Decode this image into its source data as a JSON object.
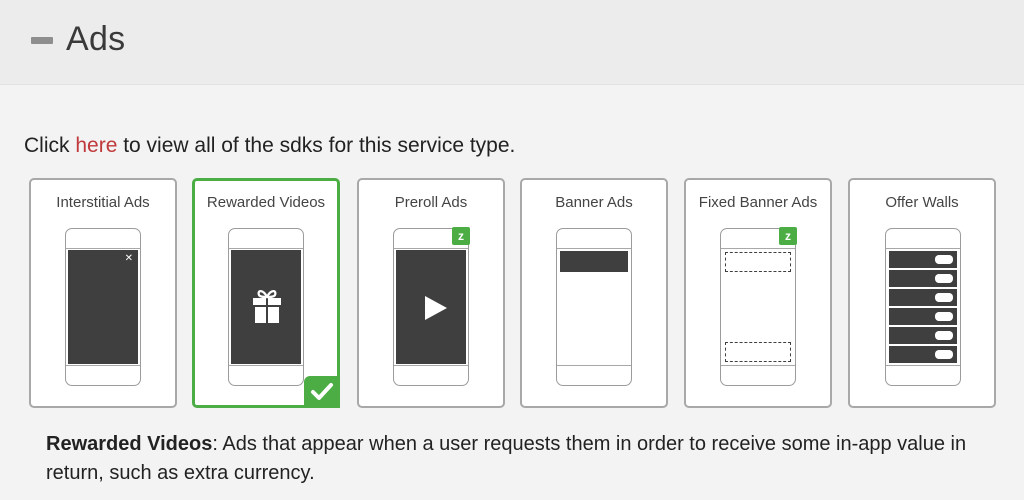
{
  "section": {
    "title": "Ads"
  },
  "intro": {
    "prefix": "Click ",
    "link": "here",
    "suffix": " to view all of the sdks for this service type."
  },
  "cards": [
    {
      "label": "Interstitial Ads",
      "selected": false
    },
    {
      "label": "Rewarded Videos",
      "selected": true
    },
    {
      "label": "Preroll Ads",
      "selected": false
    },
    {
      "label": "Banner Ads",
      "selected": false
    },
    {
      "label": "Fixed Banner Ads",
      "selected": false
    },
    {
      "label": "Offer Walls",
      "selected": false
    }
  ],
  "badges": {
    "z": "z"
  },
  "description": {
    "term": "Rewarded Videos",
    "text": ": Ads that appear when a user requests them in order to receive some in-app value in return, such as extra currency."
  },
  "colors": {
    "accent": "#4cad45",
    "link": "#c0393b",
    "screen": "#3f3f3f"
  },
  "icons": [
    "collapse-icon",
    "close-icon",
    "gift-icon",
    "play-icon",
    "checkmark-icon",
    "z-badge-icon"
  ]
}
